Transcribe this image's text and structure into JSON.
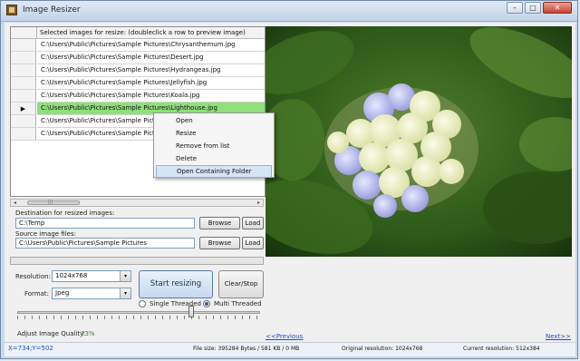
{
  "window": {
    "title": "Image Resizer",
    "minimize": "–",
    "maximize": "□",
    "close": "✕",
    "icon": "app-photo-icon"
  },
  "grid": {
    "header": "Selected images for resize: (doubleclick a row to preview image)",
    "current_marker": "▶",
    "rows": [
      "C:\\Users\\Public\\Pictures\\Sample Pictures\\Chrysanthemum.jpg",
      "C:\\Users\\Public\\Pictures\\Sample Pictures\\Desert.jpg",
      "C:\\Users\\Public\\Pictures\\Sample Pictures\\Hydrangeas.jpg",
      "C:\\Users\\Public\\Pictures\\Sample Pictures\\Jellyfish.jpg",
      "C:\\Users\\Public\\Pictures\\Sample Pictures\\Koala.jpg",
      "C:\\Users\\Public\\Pictures\\Sample Pictures\\Lighthouse.jpg",
      "C:\\Users\\Public\\Pictures\\Sample Pictures\\Penguins.jpg",
      "C:\\Users\\Public\\Pictures\\Sample Pictures\\Tulips.jpg"
    ],
    "scroll_left": "◂",
    "scroll_right": "▸",
    "scroll_thumb_grip": "|||"
  },
  "context_menu": {
    "items": [
      "Open",
      "Resize",
      "Remove from list",
      "Delete",
      "Open Containing Folder"
    ]
  },
  "destination": {
    "label": "Destination for resized images:",
    "value": "C:\\Temp",
    "browse": "Browse",
    "load": "Load"
  },
  "source": {
    "label": "Source image files:",
    "value": "C:\\Users\\Public\\Pictures\\Sample Pictures",
    "browse": "Browse",
    "load": "Load"
  },
  "options": {
    "resolution_label": "Resolution:",
    "resolution_value": "1024x768",
    "format_label": "Format:",
    "format_value": "Jpeg",
    "dropdown_arrow": "▾",
    "start_button": "Start resizing",
    "clear_button": "Clear/Stop",
    "single_threaded": "Single Threaded",
    "multi_threaded": "Multi Threaded",
    "quality_label": "Adjust Image Quality:",
    "quality_value": "73%"
  },
  "navigation": {
    "previous": "<<Previous",
    "next": "Next>>"
  },
  "status": {
    "coords": "X=734;Y=502",
    "file_size": "File size:  395284 Bytes / 581 KB / 0 MB",
    "original_resolution": "Original resolution:   1024x768",
    "current_resolution": "Current resolution:   512x384"
  },
  "colors": {
    "selected_row": "#8ee07a",
    "link": "#1a4dcc",
    "quality_text": "#2e8b2e"
  }
}
